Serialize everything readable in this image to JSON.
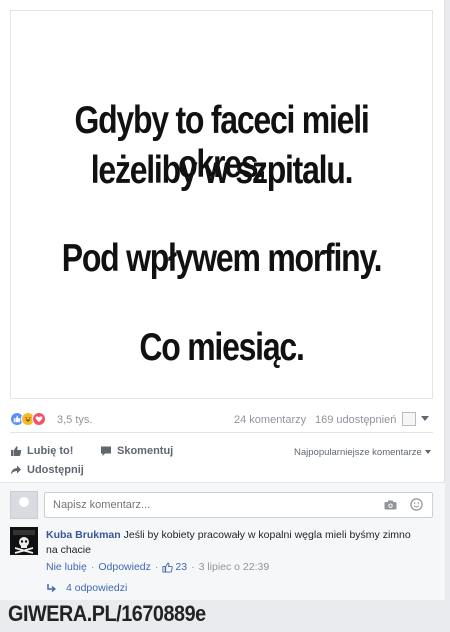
{
  "meme": {
    "line1": "Gdyby to faceci mieli okres,",
    "line2": "leżeliby w szpitalu.",
    "line3": "Pod wpływem morfiny.",
    "line4": "Co miesiąc."
  },
  "stats": {
    "reactions_count": "3,5 tys.",
    "comments_count": "24 komentarzy",
    "shares_count": "169 udostępnień"
  },
  "actions": {
    "like": "Lubię to!",
    "comment": "Skomentuj",
    "share": "Udostępnij",
    "sort": "Najpopularniejsze komentarze"
  },
  "comment_box": {
    "placeholder": "Napisz komentarz..."
  },
  "comment": {
    "author": "Kuba Brukman",
    "text": "Jeśli by kobiety pracowały w kopalni węgla mieli byśmy zimno na chacie",
    "unlike": "Nie lubię",
    "separator": "·",
    "reply": "Odpowiedz",
    "likes": "23",
    "date": "3 lipiec o 22:39",
    "replies": "4 odpowiedzi"
  },
  "watermark": "GIWERA.PL/1670889e",
  "icons": [
    "like-reaction-icon",
    "haha-reaction-icon",
    "love-reaction-icon",
    "thumbs-up-icon",
    "comment-icon",
    "share-arrow-icon",
    "camera-icon",
    "emoji-icon",
    "reply-arrow-icon"
  ],
  "colors": {
    "link": "#365899",
    "muted": "#90949c",
    "background": "#e9ebee"
  }
}
